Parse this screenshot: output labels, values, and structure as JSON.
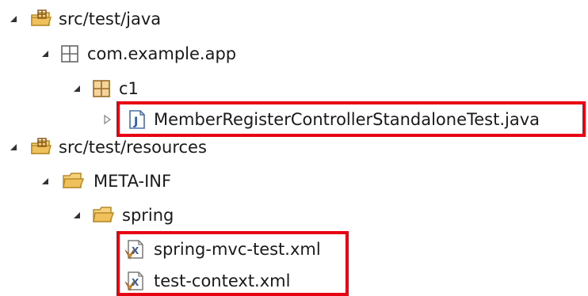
{
  "tree": {
    "nodes": [
      {
        "label": "src/test/java",
        "expander": "expanded",
        "icon": "source-folder-icon"
      },
      {
        "label": "com.example.app",
        "expander": "expanded",
        "icon": "empty-package-icon"
      },
      {
        "label": "c1",
        "expander": "expanded",
        "icon": "package-icon"
      },
      {
        "label": "MemberRegisterControllerStandaloneTest.java",
        "expander": "collapsed",
        "icon": "java-file-icon"
      },
      {
        "label": "src/test/resources",
        "expander": "expanded",
        "icon": "source-folder-icon"
      },
      {
        "label": "META-INF",
        "expander": "expanded",
        "icon": "folder-icon"
      },
      {
        "label": "spring",
        "expander": "expanded",
        "icon": "folder-icon"
      },
      {
        "label": "spring-mvc-test.xml",
        "expander": "none",
        "icon": "xml-file-icon"
      },
      {
        "label": "test-context.xml",
        "expander": "none",
        "icon": "xml-file-icon"
      }
    ]
  },
  "colors": {
    "highlight": "#e60012",
    "folder": "#e8b04a",
    "package": "#b07a3a",
    "java": "#3a6fb0"
  }
}
